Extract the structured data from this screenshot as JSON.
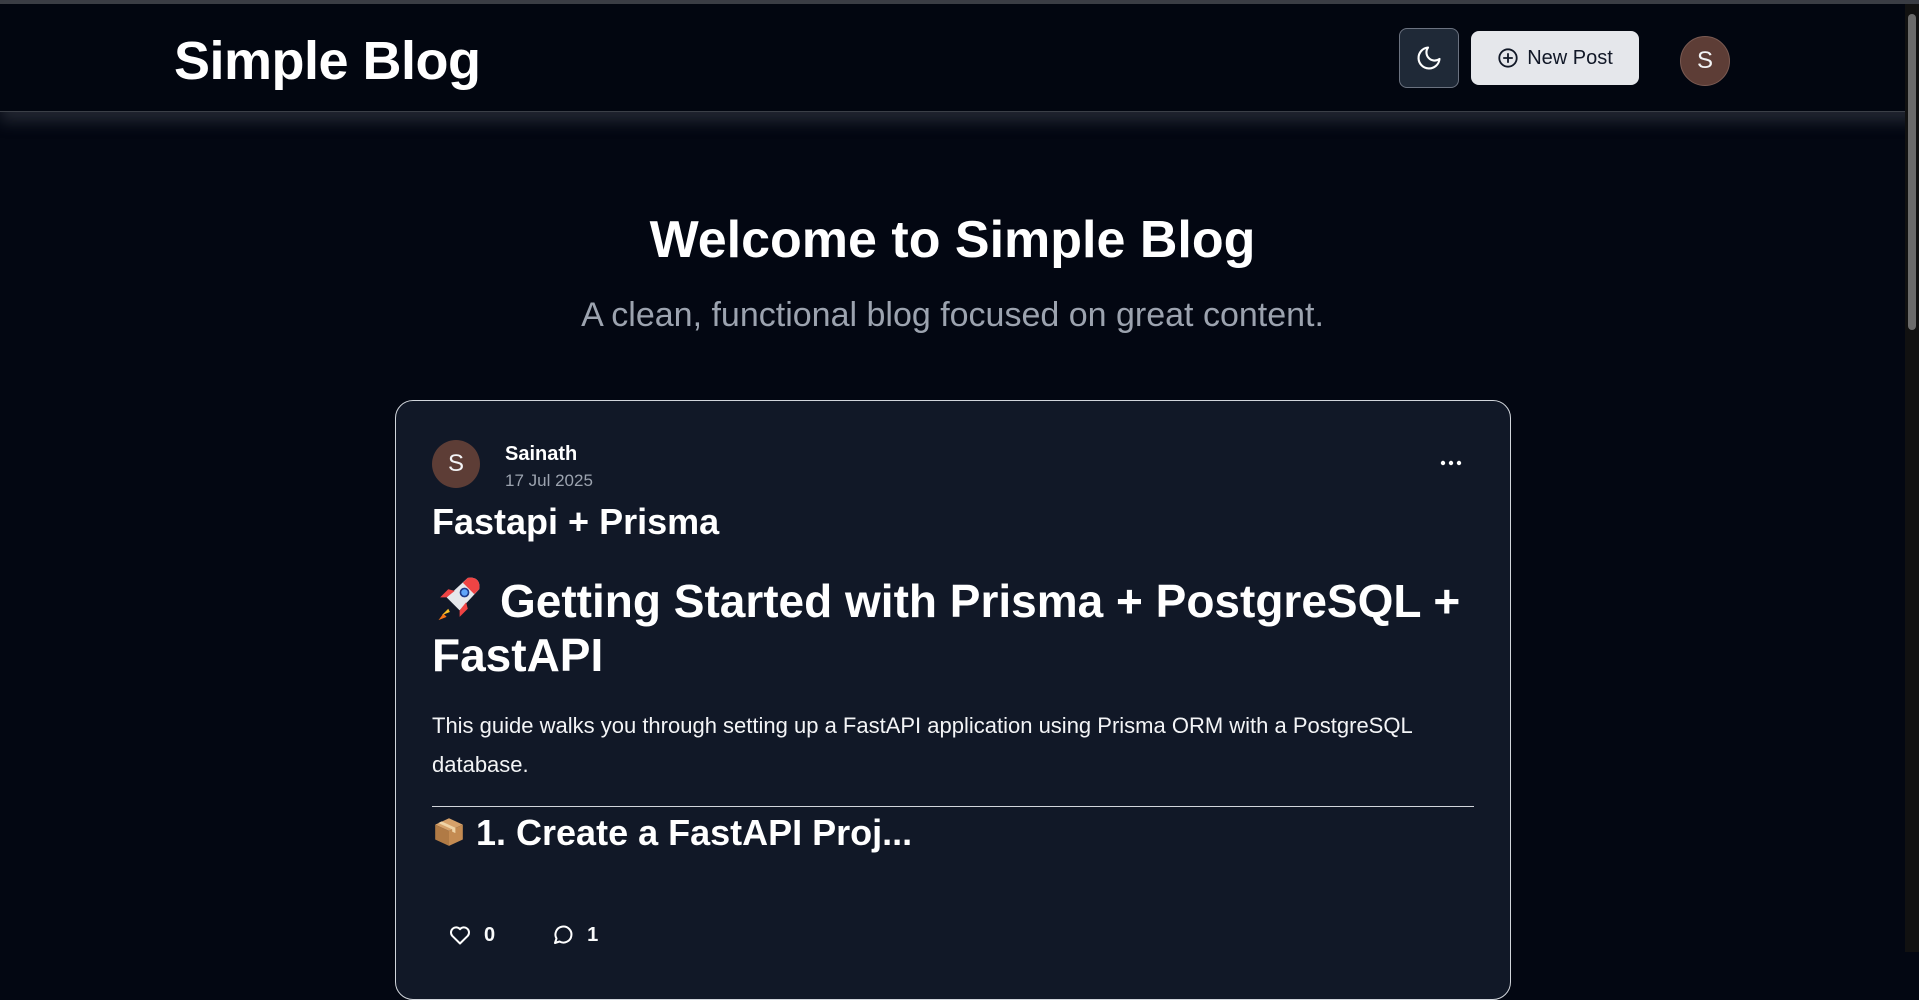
{
  "navbar": {
    "brand": "Simple Blog",
    "theme_icon": "moon-icon",
    "new_post_label": "New Post",
    "new_post_icon": "plus-circle-icon",
    "avatar_initial": "S"
  },
  "hero": {
    "title": "Welcome to Simple Blog",
    "subtitle": "A clean, functional blog focused on great content."
  },
  "post": {
    "author": "Sainath",
    "author_initial": "S",
    "date": "17 Jul 2025",
    "title": "Fastapi + Prisma",
    "content_heading": "Getting Started with Prisma + PostgreSQL + FastAPI",
    "content_paragraph": "This guide walks you through setting up a FastAPI application using Prisma ORM with a PostgreSQL database.",
    "content_subheading": "1. Create a FastAPI Proj...",
    "likes": "0",
    "comments": "1"
  },
  "colors": {
    "background": "#030712",
    "card": "#111827",
    "avatar": "#5d3d36",
    "button_light": "#e5e7eb"
  }
}
